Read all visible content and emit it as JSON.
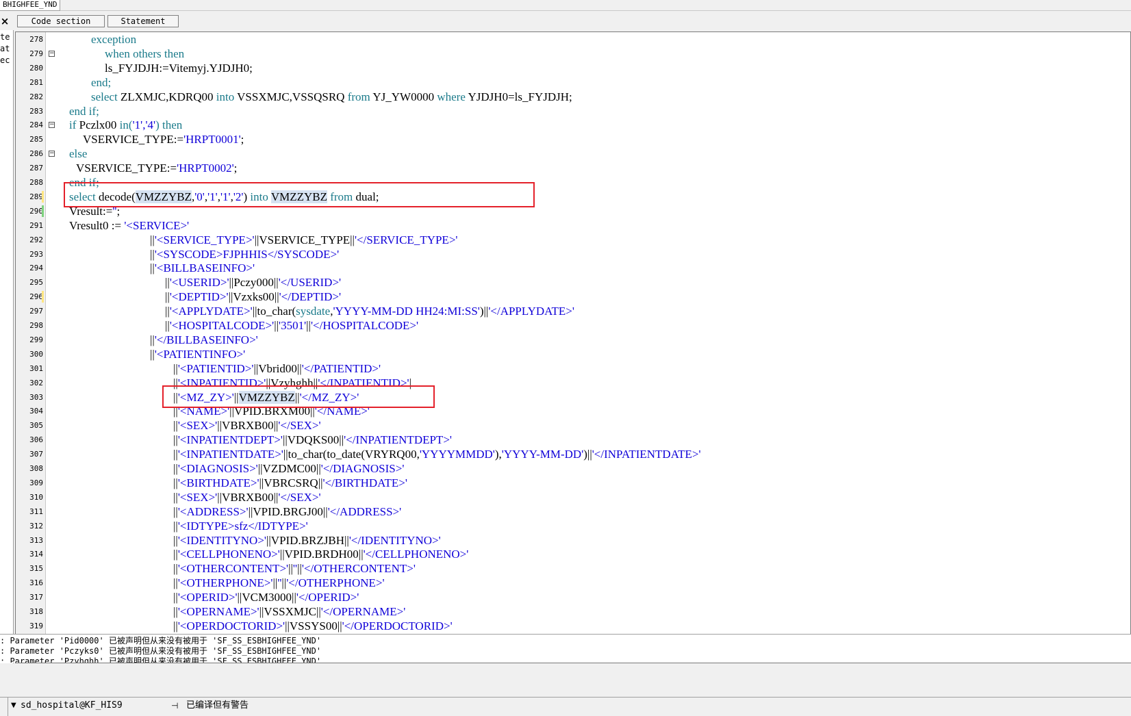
{
  "window": {
    "title_fragment": "BHIGHFEE_YND"
  },
  "toolbar": {
    "close_glyph": "×",
    "tab_code": "Code section",
    "tab_statement": "Statement"
  },
  "left_panel": {
    "items": [
      "te",
      "at",
      "ec"
    ]
  },
  "editor": {
    "lines": [
      {
        "n": "278",
        "indent": 32,
        "fold": false,
        "tokens": [
          {
            "t": "exception",
            "c": "kw"
          }
        ]
      },
      {
        "n": "279",
        "indent": 52,
        "fold": true,
        "tokens": [
          {
            "t": "when others then",
            "c": "kw"
          }
        ]
      },
      {
        "n": "280",
        "indent": 52,
        "fold": false,
        "tokens": [
          {
            "t": "ls_FYJDJH:=Vitemyj.YJDJH0;",
            "c": "fn"
          }
        ]
      },
      {
        "n": "281",
        "indent": 32,
        "fold": false,
        "tokens": [
          {
            "t": "end;",
            "c": "kw"
          }
        ]
      },
      {
        "n": "282",
        "indent": 32,
        "fold": false,
        "tokens": [
          {
            "t": "select ",
            "c": "kw"
          },
          {
            "t": "ZLXMJC,KDRQ00 ",
            "c": "fn"
          },
          {
            "t": "into ",
            "c": "kw"
          },
          {
            "t": "VSSXMJC,VSSQSRQ ",
            "c": "fn"
          },
          {
            "t": "from ",
            "c": "kw"
          },
          {
            "t": "YJ_YW0000 ",
            "c": "fn"
          },
          {
            "t": "where ",
            "c": "kw"
          },
          {
            "t": "YJDJH0=ls_FYJDJH;",
            "c": "fn"
          }
        ]
      },
      {
        "n": "283",
        "indent": 0,
        "fold": false,
        "tokens": [
          {
            "t": "end if;",
            "c": "kw"
          }
        ]
      },
      {
        "n": "284",
        "indent": 0,
        "fold": true,
        "tokens": [
          {
            "t": "if ",
            "c": "kw"
          },
          {
            "t": "Pczlx00 ",
            "c": "fn"
          },
          {
            "t": "in(",
            "c": "kw"
          },
          {
            "t": "'1','4'",
            "c": "str"
          },
          {
            "t": ") then",
            "c": "kw"
          }
        ]
      },
      {
        "n": "285",
        "indent": 20,
        "fold": false,
        "tokens": [
          {
            "t": "VSERVICE_TYPE:=",
            "c": "fn"
          },
          {
            "t": "'HRPT0001'",
            "c": "str"
          },
          {
            "t": ";",
            "c": "fn"
          }
        ]
      },
      {
        "n": "286",
        "indent": 0,
        "fold": true,
        "tokens": [
          {
            "t": "else",
            "c": "kw"
          }
        ]
      },
      {
        "n": "287",
        "indent": 10,
        "fold": false,
        "tokens": [
          {
            "t": "VSERVICE_TYPE:=",
            "c": "fn"
          },
          {
            "t": "'HRPT0002'",
            "c": "str"
          },
          {
            "t": ";",
            "c": "fn"
          }
        ]
      },
      {
        "n": "288",
        "indent": 0,
        "fold": false,
        "tokens": [
          {
            "t": "end if;",
            "c": "kw"
          }
        ]
      },
      {
        "n": "289",
        "indent": 0,
        "fold": false,
        "mark": "#ffe680",
        "tokens": [
          {
            "t": "select ",
            "c": "kw"
          },
          {
            "t": "decode(",
            "c": "fn"
          },
          {
            "t": "VMZZYBZ",
            "c": "fn hl"
          },
          {
            "t": ",",
            "c": "fn"
          },
          {
            "t": "'0'",
            "c": "str"
          },
          {
            "t": ",",
            "c": "fn"
          },
          {
            "t": "'1'",
            "c": "str"
          },
          {
            "t": ",",
            "c": "fn"
          },
          {
            "t": "'1'",
            "c": "str"
          },
          {
            "t": ",",
            "c": "fn"
          },
          {
            "t": "'2'",
            "c": "str"
          },
          {
            "t": ") ",
            "c": "fn"
          },
          {
            "t": "into ",
            "c": "kw"
          },
          {
            "t": "VMZZYBZ",
            "c": "fn hl"
          },
          {
            "t": " from ",
            "c": "kw"
          },
          {
            "t": "dual;",
            "c": "fn"
          }
        ]
      },
      {
        "n": "290",
        "indent": 0,
        "fold": false,
        "mark": "#7ed37e",
        "tokens": [
          {
            "t": "Vresult:=",
            "c": "fn"
          },
          {
            "t": "''",
            "c": "str"
          },
          {
            "t": ";",
            "c": "fn"
          }
        ]
      },
      {
        "n": "291",
        "indent": 0,
        "fold": false,
        "tokens": [
          {
            "t": "Vresult0 := ",
            "c": "fn"
          },
          {
            "t": "'<SERVICE>'",
            "c": "str"
          }
        ]
      },
      {
        "n": "292",
        "indent": 118,
        "fold": false,
        "tokens": [
          {
            "t": "||",
            "c": "fn"
          },
          {
            "t": "'<SERVICE_TYPE>'",
            "c": "str"
          },
          {
            "t": "||VSERVICE_TYPE||",
            "c": "fn"
          },
          {
            "t": "'</SERVICE_TYPE>'",
            "c": "str"
          }
        ]
      },
      {
        "n": "293",
        "indent": 118,
        "fold": false,
        "tokens": [
          {
            "t": "||",
            "c": "fn"
          },
          {
            "t": "'<SYSCODE>FJPHHIS</SYSCODE>'",
            "c": "str"
          }
        ]
      },
      {
        "n": "294",
        "indent": 118,
        "fold": false,
        "tokens": [
          {
            "t": "||",
            "c": "fn"
          },
          {
            "t": "'<BILLBASEINFO>'",
            "c": "str"
          }
        ]
      },
      {
        "n": "295",
        "indent": 140,
        "fold": false,
        "tokens": [
          {
            "t": "||",
            "c": "fn"
          },
          {
            "t": "'<USERID>'",
            "c": "str"
          },
          {
            "t": "||Pczy000||",
            "c": "fn"
          },
          {
            "t": "'</USERID>'",
            "c": "str"
          }
        ]
      },
      {
        "n": "296",
        "indent": 140,
        "fold": false,
        "mark": "#ffe680",
        "tokens": [
          {
            "t": "||",
            "c": "fn"
          },
          {
            "t": "'<DEPTID>'",
            "c": "str"
          },
          {
            "t": "||Vzxks00||",
            "c": "fn"
          },
          {
            "t": "'</DEPTID>'",
            "c": "str"
          }
        ]
      },
      {
        "n": "297",
        "indent": 140,
        "fold": false,
        "tokens": [
          {
            "t": "||",
            "c": "fn"
          },
          {
            "t": "'<APPLYDATE>'",
            "c": "str"
          },
          {
            "t": "||to_char(",
            "c": "fn"
          },
          {
            "t": "sysdate",
            "c": "kw"
          },
          {
            "t": ",",
            "c": "fn"
          },
          {
            "t": "'YYYY-MM-DD HH24:MI:SS'",
            "c": "str"
          },
          {
            "t": ")||",
            "c": "fn"
          },
          {
            "t": "'</APPLYDATE>'",
            "c": "str"
          }
        ]
      },
      {
        "n": "298",
        "indent": 140,
        "fold": false,
        "tokens": [
          {
            "t": "||",
            "c": "fn"
          },
          {
            "t": "'<HOSPITALCODE>'",
            "c": "str"
          },
          {
            "t": "||",
            "c": "fn"
          },
          {
            "t": "'3501'",
            "c": "str"
          },
          {
            "t": "||",
            "c": "fn"
          },
          {
            "t": "'</HOSPITALCODE>'",
            "c": "str"
          }
        ]
      },
      {
        "n": "299",
        "indent": 118,
        "fold": false,
        "tokens": [
          {
            "t": "||",
            "c": "fn"
          },
          {
            "t": "'</BILLBASEINFO>'",
            "c": "str"
          }
        ]
      },
      {
        "n": "300",
        "indent": 118,
        "fold": false,
        "tokens": [
          {
            "t": "||",
            "c": "fn"
          },
          {
            "t": "'<PATIENTINFO>'",
            "c": "str"
          }
        ]
      },
      {
        "n": "301",
        "indent": 152,
        "fold": false,
        "tokens": [
          {
            "t": "||",
            "c": "fn"
          },
          {
            "t": "'<PATIENTID>'",
            "c": "str"
          },
          {
            "t": "||Vbrid00||",
            "c": "fn"
          },
          {
            "t": "'</PATIENTID>'",
            "c": "str"
          }
        ]
      },
      {
        "n": "302",
        "indent": 152,
        "fold": false,
        "tokens": [
          {
            "t": "||",
            "c": "fn"
          },
          {
            "t": "'<INPATIENTID>'",
            "c": "str"
          },
          {
            "t": "||Vzyhghh||",
            "c": "fn"
          },
          {
            "t": "'</INPATIENTID>'",
            "c": "str"
          },
          {
            "t": "|",
            "c": "fn"
          }
        ]
      },
      {
        "n": "303",
        "indent": 152,
        "fold": false,
        "tokens": [
          {
            "t": "||",
            "c": "fn"
          },
          {
            "t": "'<MZ_ZY>'",
            "c": "str"
          },
          {
            "t": "||",
            "c": "fn"
          },
          {
            "t": "VMZZYBZ",
            "c": "fn hl"
          },
          {
            "t": "||",
            "c": "fn"
          },
          {
            "t": "'</MZ_ZY>'",
            "c": "str"
          }
        ]
      },
      {
        "n": "304",
        "indent": 152,
        "fold": false,
        "tokens": [
          {
            "t": "||",
            "c": "fn"
          },
          {
            "t": "'<NAME>'",
            "c": "str"
          },
          {
            "t": "||VPID.BRXM00||",
            "c": "fn"
          },
          {
            "t": "'</NAME>'",
            "c": "str"
          }
        ]
      },
      {
        "n": "305",
        "indent": 152,
        "fold": false,
        "tokens": [
          {
            "t": "||",
            "c": "fn"
          },
          {
            "t": "'<SEX>'",
            "c": "str"
          },
          {
            "t": "||VBRXB00||",
            "c": "fn"
          },
          {
            "t": "'</SEX>'",
            "c": "str"
          }
        ]
      },
      {
        "n": "306",
        "indent": 152,
        "fold": false,
        "tokens": [
          {
            "t": "||",
            "c": "fn"
          },
          {
            "t": "'<INPATIENTDEPT>'",
            "c": "str"
          },
          {
            "t": "||VDQKS00||",
            "c": "fn"
          },
          {
            "t": "'</INPATIENTDEPT>'",
            "c": "str"
          }
        ]
      },
      {
        "n": "307",
        "indent": 152,
        "fold": false,
        "tokens": [
          {
            "t": "||",
            "c": "fn"
          },
          {
            "t": "'<INPATIENTDATE>'",
            "c": "str"
          },
          {
            "t": "||to_char(to_date(VRYRQ00,",
            "c": "fn"
          },
          {
            "t": "'YYYYMMDD'",
            "c": "str"
          },
          {
            "t": "),",
            "c": "fn"
          },
          {
            "t": "'YYYY-MM-DD'",
            "c": "str"
          },
          {
            "t": ")||",
            "c": "fn"
          },
          {
            "t": "'</INPATIENTDATE>'",
            "c": "str"
          }
        ]
      },
      {
        "n": "308",
        "indent": 152,
        "fold": false,
        "tokens": [
          {
            "t": "||",
            "c": "fn"
          },
          {
            "t": "'<DIAGNOSIS>'",
            "c": "str"
          },
          {
            "t": "||VZDMC00||",
            "c": "fn"
          },
          {
            "t": "'</DIAGNOSIS>'",
            "c": "str"
          }
        ]
      },
      {
        "n": "309",
        "indent": 152,
        "fold": false,
        "tokens": [
          {
            "t": "||",
            "c": "fn"
          },
          {
            "t": "'<BIRTHDATE>'",
            "c": "str"
          },
          {
            "t": "||VBRCSRQ||",
            "c": "fn"
          },
          {
            "t": "'</BIRTHDATE>'",
            "c": "str"
          }
        ]
      },
      {
        "n": "310",
        "indent": 152,
        "fold": false,
        "tokens": [
          {
            "t": "||",
            "c": "fn"
          },
          {
            "t": "'<SEX>'",
            "c": "str"
          },
          {
            "t": "||VBRXB00||",
            "c": "fn"
          },
          {
            "t": "'</SEX>'",
            "c": "str"
          }
        ]
      },
      {
        "n": "311",
        "indent": 152,
        "fold": false,
        "tokens": [
          {
            "t": "||",
            "c": "fn"
          },
          {
            "t": "'<ADDRESS>'",
            "c": "str"
          },
          {
            "t": "||VPID.BRGJ00||",
            "c": "fn"
          },
          {
            "t": "'</ADDRESS>'",
            "c": "str"
          }
        ]
      },
      {
        "n": "312",
        "indent": 152,
        "fold": false,
        "tokens": [
          {
            "t": "||",
            "c": "fn"
          },
          {
            "t": "'<IDTYPE>sfz</IDTYPE>'",
            "c": "str"
          }
        ]
      },
      {
        "n": "313",
        "indent": 152,
        "fold": false,
        "tokens": [
          {
            "t": "||",
            "c": "fn"
          },
          {
            "t": "'<IDENTITYNO>'",
            "c": "str"
          },
          {
            "t": "||VPID.BRZJBH||",
            "c": "fn"
          },
          {
            "t": "'</IDENTITYNO>'",
            "c": "str"
          }
        ]
      },
      {
        "n": "314",
        "indent": 152,
        "fold": false,
        "tokens": [
          {
            "t": "||",
            "c": "fn"
          },
          {
            "t": "'<CELLPHONENO>'",
            "c": "str"
          },
          {
            "t": "||VPID.BRDH00||",
            "c": "fn"
          },
          {
            "t": "'</CELLPHONENO>'",
            "c": "str"
          }
        ]
      },
      {
        "n": "315",
        "indent": 152,
        "fold": false,
        "tokens": [
          {
            "t": "||",
            "c": "fn"
          },
          {
            "t": "'<OTHERCONTENT>'",
            "c": "str"
          },
          {
            "t": "||",
            "c": "fn"
          },
          {
            "t": "''",
            "c": "str"
          },
          {
            "t": "||",
            "c": "fn"
          },
          {
            "t": "'</OTHERCONTENT>'",
            "c": "str"
          }
        ]
      },
      {
        "n": "316",
        "indent": 152,
        "fold": false,
        "tokens": [
          {
            "t": "||",
            "c": "fn"
          },
          {
            "t": "'<OTHERPHONE>'",
            "c": "str"
          },
          {
            "t": "||",
            "c": "fn"
          },
          {
            "t": "''",
            "c": "str"
          },
          {
            "t": "||",
            "c": "fn"
          },
          {
            "t": "'</OTHERPHONE>'",
            "c": "str"
          }
        ]
      },
      {
        "n": "317",
        "indent": 152,
        "fold": false,
        "tokens": [
          {
            "t": "||",
            "c": "fn"
          },
          {
            "t": "'<OPERID>'",
            "c": "str"
          },
          {
            "t": "||VCM3000||",
            "c": "fn"
          },
          {
            "t": "'</OPERID>'",
            "c": "str"
          }
        ]
      },
      {
        "n": "318",
        "indent": 152,
        "fold": false,
        "tokens": [
          {
            "t": "||",
            "c": "fn"
          },
          {
            "t": "'<OPERNAME>'",
            "c": "str"
          },
          {
            "t": "||VSSXMJC||",
            "c": "fn"
          },
          {
            "t": "'</OPERNAME>'",
            "c": "str"
          }
        ]
      },
      {
        "n": "319",
        "indent": 152,
        "fold": false,
        "tokens": [
          {
            "t": "||",
            "c": "fn"
          },
          {
            "t": "'<OPERDOCTORID>'",
            "c": "str"
          },
          {
            "t": "||VSSYS00||",
            "c": "fn"
          },
          {
            "t": "'</OPERDOCTORID>'",
            "c": "str"
          }
        ]
      }
    ]
  },
  "messages": [
    ": Parameter 'Pid0000' 已被声明但从来没有被用于 'SF_SS_ESBHIGHFEE_YND'",
    ": Parameter 'Pczyks0' 已被声明但从来没有被用于 'SF_SS_ESBHIGHFEE_YND'",
    ": Parameter 'Pzyhghh' 已被声明但从来没有被用于 'SF_SS_ESBHIGHFEE_YND'"
  ],
  "status_bar": {
    "dropdown_glyph": "▼",
    "connection": "sd_hospital@KF_HIS9",
    "pin_glyph": "⊣",
    "compile_status": "已编译但有警告"
  },
  "colors": {
    "keyword": "#1a7a8a",
    "string": "#0f00d8",
    "highlight": "#d6e2f2",
    "annotation_box": "#e4202a"
  }
}
